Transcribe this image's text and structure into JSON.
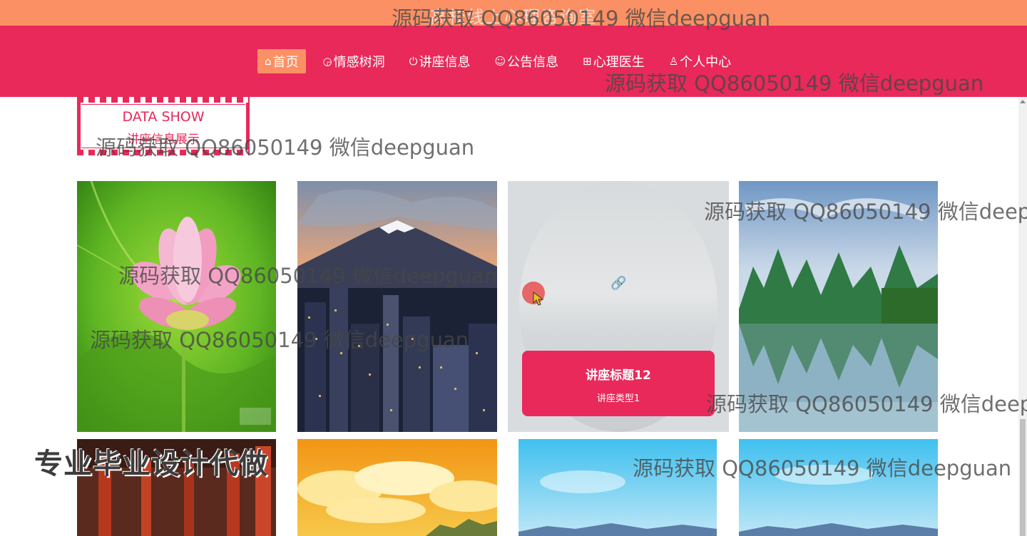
{
  "site": {
    "title": "高校线上心理咨询室"
  },
  "nav": {
    "items": [
      {
        "icon": "home-icon",
        "glyph": "⌂",
        "label": "首页",
        "active": true
      },
      {
        "icon": "gauge-icon",
        "glyph": "◶",
        "label": "情感树洞"
      },
      {
        "icon": "power-icon",
        "glyph": "⏻",
        "label": "讲座信息"
      },
      {
        "icon": "smiley-icon",
        "glyph": "☺",
        "label": "公告信息"
      },
      {
        "icon": "grid-icon",
        "glyph": "⊞",
        "label": "心理医生"
      },
      {
        "icon": "user-icon",
        "glyph": "♙",
        "label": "个人中心"
      }
    ]
  },
  "section": {
    "title_en": "DATA SHOW",
    "title_cn": "讲座信息展示"
  },
  "hover_card": {
    "title": "讲座标题12",
    "type": "讲座类型1",
    "link_glyph": "🔗"
  },
  "watermarks": {
    "text": "源码获取 QQ86050149 微信deepguan",
    "big": "专业毕业设计代做"
  },
  "colors": {
    "accent": "#e8295a",
    "topbar": "#fb9064",
    "active_nav": "#fb9064"
  }
}
